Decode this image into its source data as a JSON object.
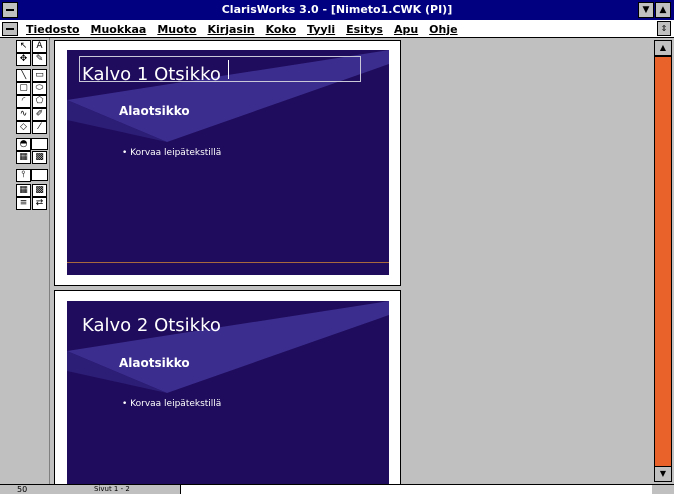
{
  "window": {
    "title": "ClarisWorks 3.0 - [Nimeto1.CWK (PI)]",
    "minimize_icon": "triangle-down-icon",
    "maximize_icon": "triangle-up-icon"
  },
  "menubar": {
    "items": [
      "Tiedosto",
      "Muokkaa",
      "Muoto",
      "Kirjasin",
      "Koko",
      "Tyyli",
      "Esitys",
      "Apu",
      "Ohje"
    ]
  },
  "slides": [
    {
      "title": "Kalvo 1 Otsikko",
      "subtitle": "Alaotsikko",
      "bullet": "• Korvaa leipätekstillä"
    },
    {
      "title": "Kalvo 2 Otsikko",
      "subtitle": "Alaotsikko",
      "bullet": "• Korvaa leipätekstillä"
    }
  ],
  "colors": {
    "slide_background": "#1f0c5c",
    "slide_accent": "#3b2d8e",
    "scrollbar_track": "#e8622a",
    "titlebar": "#000080"
  },
  "status": {
    "zoom": "50",
    "page_indicator": "Sivut 1 - 2"
  }
}
